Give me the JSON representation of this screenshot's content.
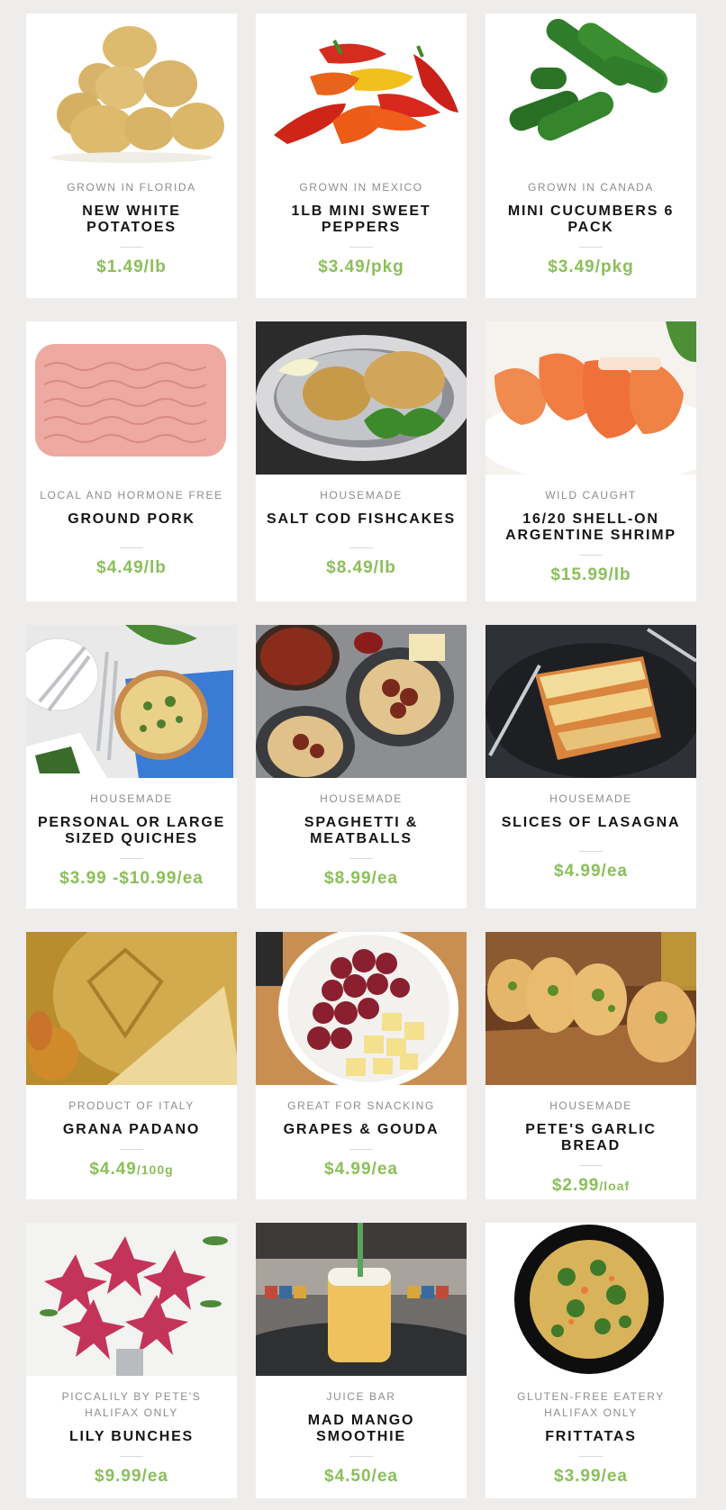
{
  "colors": {
    "background": "#efedeb",
    "card": "#ffffff",
    "price": "#8bbf5a",
    "origin": "#8d8d8d",
    "name": "#151515"
  },
  "products": [
    {
      "origin": "GROWN IN FLORIDA",
      "name": "NEW WHITE POTATOES",
      "price": "$1.49/lb",
      "image": "potatoes-photo"
    },
    {
      "origin": "GROWN IN MEXICO",
      "name": "1LB MINI SWEET PEPPERS",
      "price": "$3.49/pkg",
      "image": "peppers-photo"
    },
    {
      "origin": "GROWN IN CANADA",
      "name": "MINI CUCUMBERS 6 PACK",
      "price": "$3.49/pkg",
      "image": "cucumbers-photo"
    },
    {
      "origin": "LOCAL AND HORMONE FREE",
      "name": "GROUND PORK",
      "price": "$4.49/lb",
      "image": "ground-pork-photo"
    },
    {
      "origin": "HOUSEMADE",
      "name": "SALT COD FISHCAKES",
      "price": "$8.49/lb",
      "image": "fishcakes-photo"
    },
    {
      "origin": "WILD CAUGHT",
      "name": "16/20 SHELL-ON ARGENTINE SHRIMP",
      "price": "$15.99/lb",
      "image": "shrimp-photo"
    },
    {
      "origin": "HOUSEMADE",
      "name": "PERSONAL OR LARGE SIZED QUICHES",
      "price": "$3.99 -$10.99/ea",
      "image": "quiche-photo"
    },
    {
      "origin": "HOUSEMADE",
      "name": "SPAGHETTI & MEATBALLS",
      "price": "$8.99/ea",
      "image": "spaghetti-photo"
    },
    {
      "origin": "HOUSEMADE",
      "name": "SLICES OF LASAGNA",
      "price": "$4.99/ea",
      "image": "lasagna-photo"
    },
    {
      "origin": "PRODUCT OF ITALY",
      "name": "GRANA PADANO",
      "price_amount": "$4.49",
      "price_unit": "/100g",
      "image": "grana-padano-photo"
    },
    {
      "origin": "GREAT FOR SNACKING",
      "name": "GRAPES & GOUDA",
      "price": "$4.99/ea",
      "image": "grapes-gouda-photo"
    },
    {
      "origin": "HOUSEMADE",
      "name": "PETE'S GARLIC BREAD",
      "price_amount": "$2.99",
      "price_unit": "/loaf",
      "image": "garlic-bread-photo"
    },
    {
      "origin": "PICCALILY BY PETE'S",
      "origin2": "HALIFAX ONLY",
      "name": "LILY BUNCHES",
      "price": "$9.99/ea",
      "image": "lilies-photo"
    },
    {
      "origin": "JUICE BAR",
      "name": "MAD MANGO SMOOTHIE",
      "price": "$4.50/ea",
      "image": "smoothie-photo"
    },
    {
      "origin": "GLUTEN-FREE EATERY",
      "origin2": "HALIFAX ONLY",
      "name": "FRITTATAS",
      "price": "$3.99/ea",
      "image": "frittata-photo"
    }
  ]
}
